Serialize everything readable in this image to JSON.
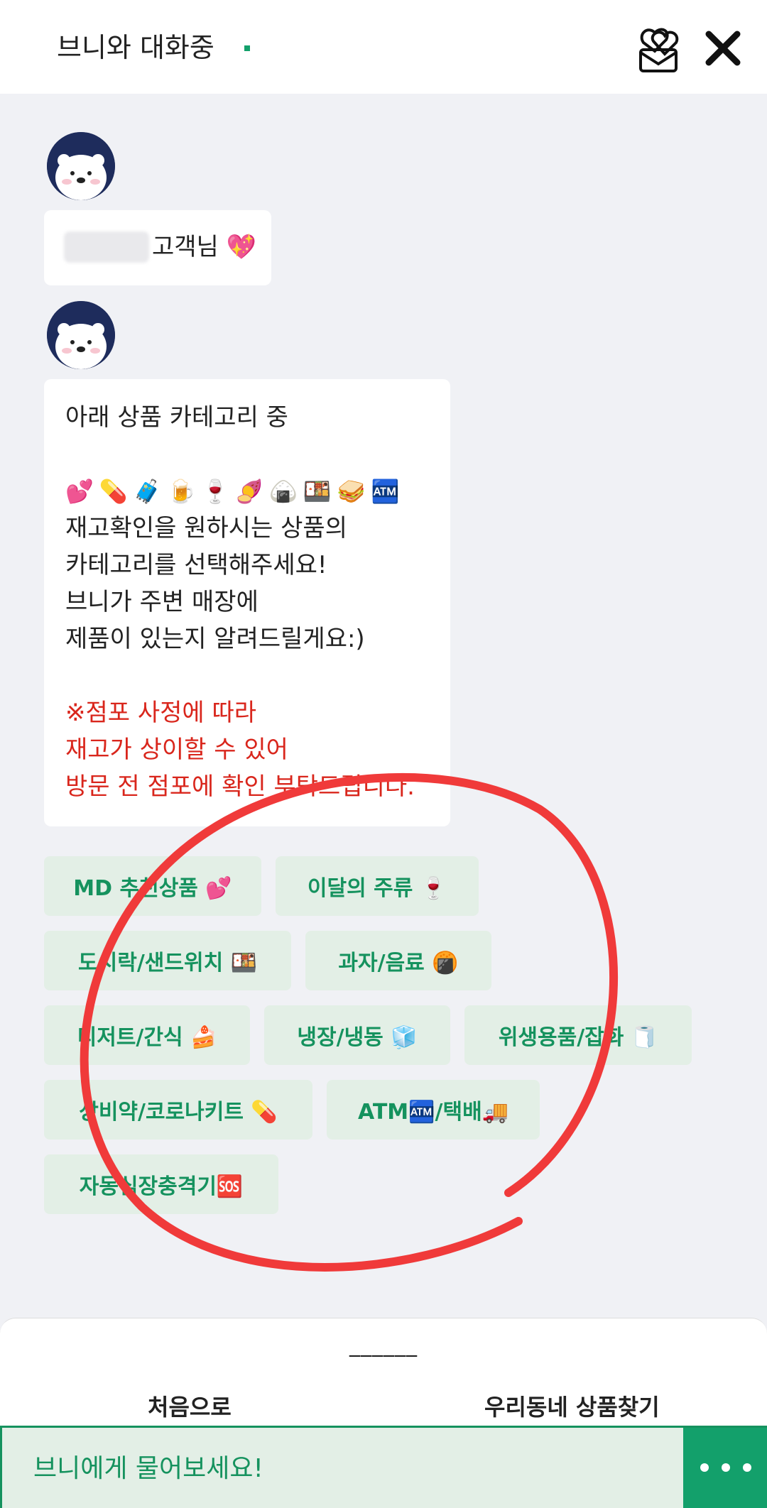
{
  "header": {
    "title": "브니와 대화중",
    "status_color": "#13a06b"
  },
  "messages": [
    {
      "greeting": "고객님 💖"
    },
    {
      "intro": "아래 상품 카테고리 중",
      "emojis": [
        "💕",
        "💊",
        "🧳",
        "🍺",
        "🍷",
        "🍠",
        "🍙",
        "🍱",
        "🥪",
        "🏧"
      ],
      "lines": [
        "재고확인을 원하시는 상품의",
        "카테고리를 선택해주세요!",
        "브니가 주변 매장에",
        "제품이 있는지 알려드릴게요:)"
      ],
      "warning": [
        "※점포 사정에 따라",
        "재고가 상이할 수 있어",
        "방문 전 점포에 확인 부탁드립니다."
      ]
    }
  ],
  "categories": [
    "MD 추천상품 💕",
    "이달의 주류 🍷",
    "도시락/샌드위치 🍱",
    "과자/음료 🍘",
    "디저트/간식 🍰",
    "냉장/냉동 🧊",
    "위생용품/잡화 🧻",
    "상비약/코로나키트 💊",
    "ATM🏧/택배🚚",
    "자동심장충격기🆘"
  ],
  "bottom": {
    "divider": "______",
    "home": "처음으로",
    "find": "우리동네 상품찾기",
    "input_placeholder": "브니에게 물어보세요!"
  },
  "colors": {
    "accent": "#13a06b",
    "chip_bg": "#e3efe6",
    "warning": "#d9261c",
    "annotation": "#f03a3a"
  },
  "icons": {
    "heart": "heart-outline-icon",
    "close": "close-icon",
    "send": "more-dots-icon"
  }
}
